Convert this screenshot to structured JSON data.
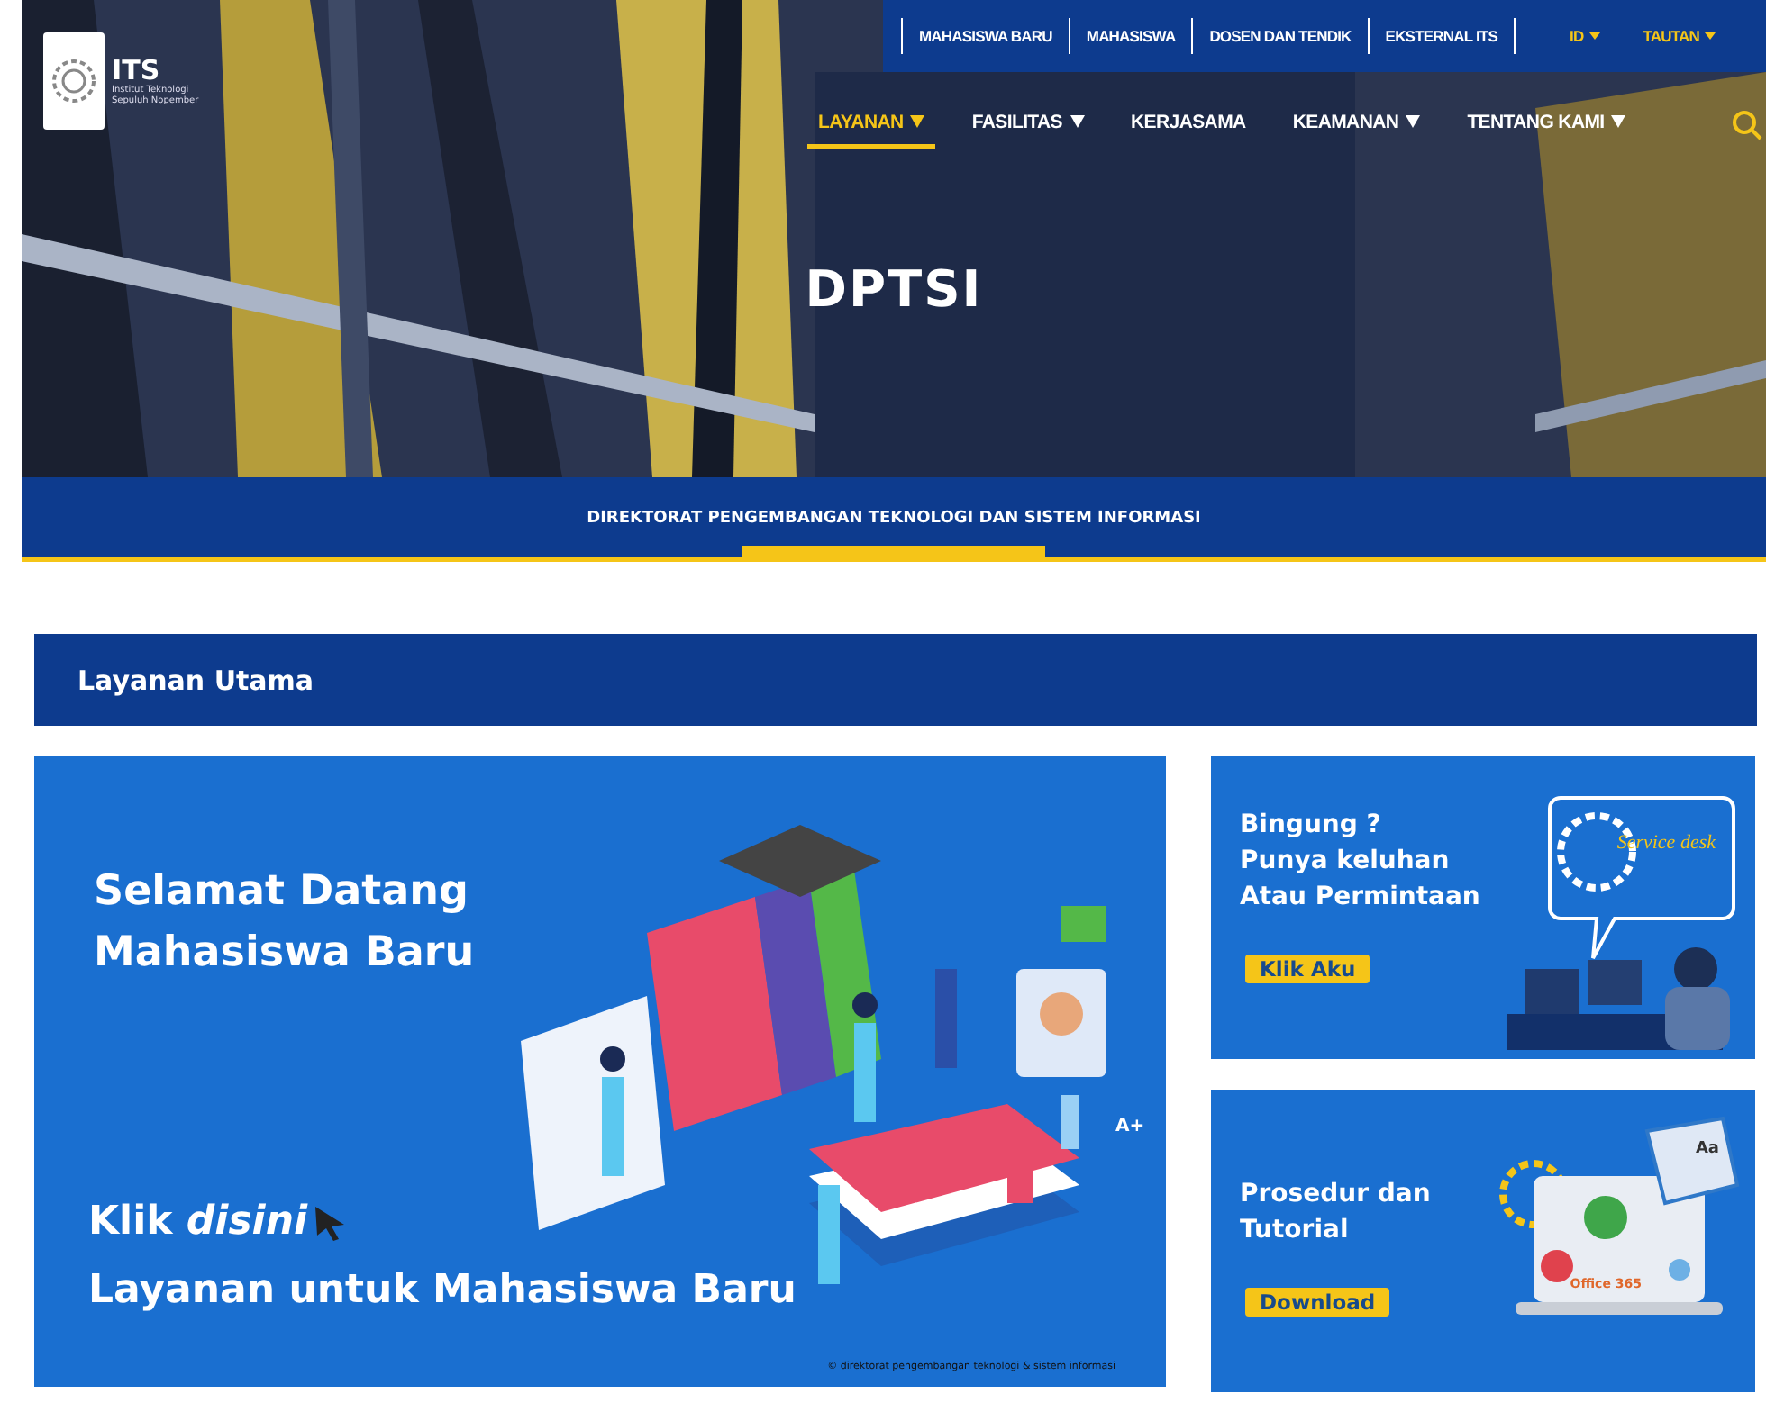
{
  "logo": {
    "name": "ITS",
    "subtitle": "Institut Teknologi Sepuluh Nopember"
  },
  "top_links": [
    {
      "label": "MAHASISWA BARU"
    },
    {
      "label": "MAHASISWA"
    },
    {
      "label": "DOSEN DAN TENDIK"
    },
    {
      "label": "EKSTERNAL ITS"
    }
  ],
  "top_dropdowns": [
    {
      "label": "ID"
    },
    {
      "label": "TAUTAN"
    }
  ],
  "nav": [
    {
      "label": "LAYANAN",
      "dropdown": true,
      "selected": true
    },
    {
      "label": "FASILITAS",
      "dropdown": true,
      "selected": false
    },
    {
      "label": "KERJASAMA",
      "dropdown": false,
      "selected": false
    },
    {
      "label": "KEAMANAN",
      "dropdown": true,
      "selected": false
    },
    {
      "label": "TENTANG KAMI",
      "dropdown": true,
      "selected": false
    }
  ],
  "hero": {
    "kind": "picture",
    "title": "DPTSI"
  },
  "band": {
    "title": "DIREKTORAT PENGEMBANGAN TEKNOLOGI DAN SISTEM INFORMASI"
  },
  "section": {
    "title": "Layanan Utama"
  },
  "main_banner": {
    "greeting": "Selamat Datang\nMahasiswa Baru",
    "cta": "Klik *disini*",
    "caption": "Layanan untuk Mahasiswa Baru",
    "badge": "A+",
    "copyright": "© direktorat pengembangan teknologi & sistem informasi"
  },
  "side_banners": [
    {
      "kind": "service",
      "text": "Bingung ?\nPunya keluhan\nAtau Permintaan",
      "button": "Klik Aku",
      "art_texts": [
        "Service desk"
      ]
    },
    {
      "kind": "tutorial",
      "text": "Prosedur dan\nTutorial",
      "button": "Download",
      "art_texts": [
        "Office 365",
        "Aa"
      ]
    }
  ]
}
